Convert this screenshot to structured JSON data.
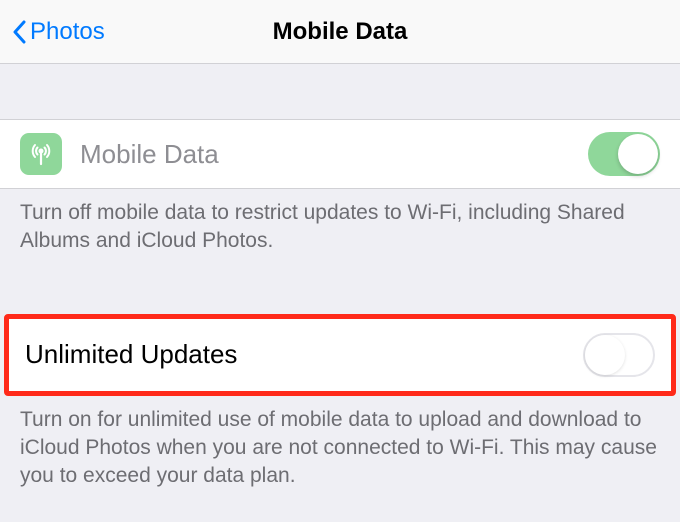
{
  "header": {
    "back_label": "Photos",
    "title": "Mobile Data"
  },
  "mobile_data": {
    "label": "Mobile Data",
    "enabled": true,
    "icon": "antenna-icon",
    "footer": "Turn off mobile data to restrict updates to Wi-Fi, including Shared Albums and iCloud Photos."
  },
  "unlimited_updates": {
    "label": "Unlimited Updates",
    "enabled": false,
    "footer": "Turn on for unlimited use of mobile data to upload and download to iCloud Photos when you are not connected to Wi-Fi. This may cause you to exceed your data plan."
  }
}
